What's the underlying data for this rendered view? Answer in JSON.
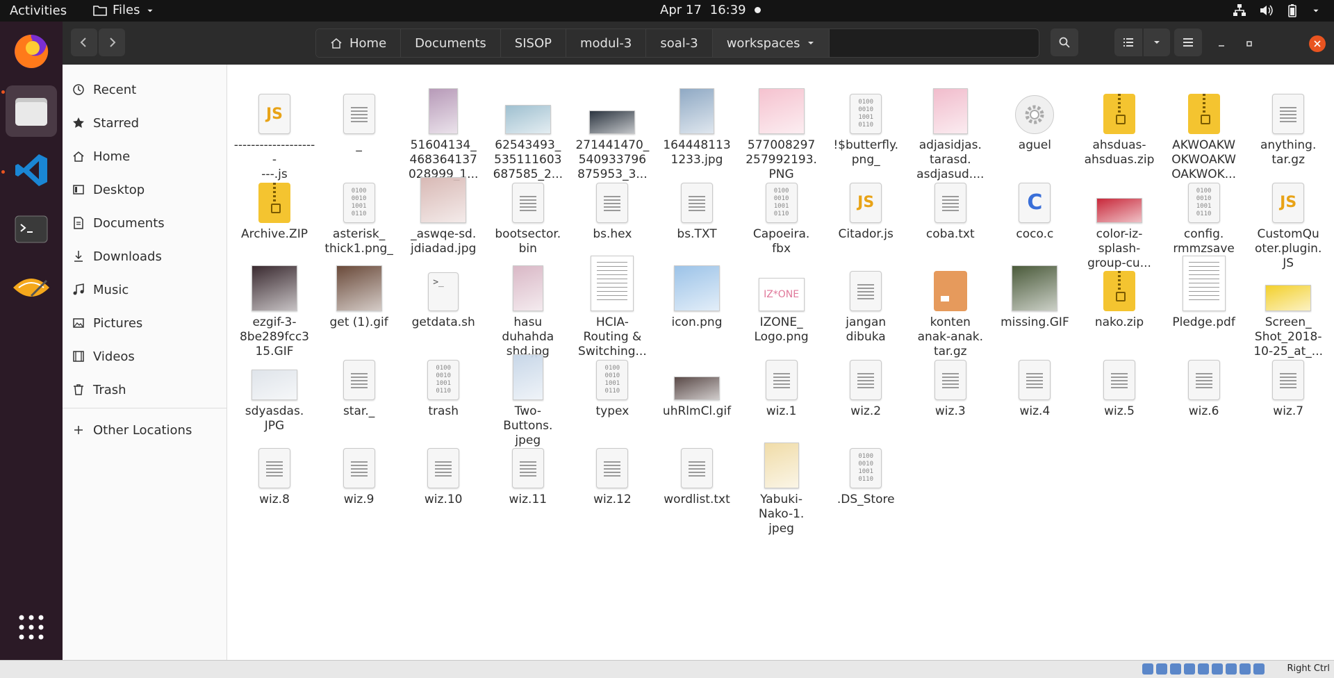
{
  "topbar": {
    "activities": "Activities",
    "app_name": "Files",
    "date": "Apr 17",
    "time": "16:39"
  },
  "dock": {
    "items": [
      "firefox-icon",
      "files-icon",
      "vscode-icon",
      "terminal-icon",
      "gedit-icon",
      "show-apps-icon"
    ]
  },
  "pathbar": {
    "crumbs": [
      "Home",
      "Documents",
      "SISOP",
      "modul-3",
      "soal-3",
      "workspaces"
    ]
  },
  "sidebar": {
    "items": [
      {
        "label": "Recent",
        "icon": "clock-icon"
      },
      {
        "label": "Starred",
        "icon": "star-icon"
      },
      {
        "label": "Home",
        "icon": "home-icon"
      },
      {
        "label": "Desktop",
        "icon": "desktop-icon"
      },
      {
        "label": "Documents",
        "icon": "documents-icon"
      },
      {
        "label": "Downloads",
        "icon": "downloads-icon"
      },
      {
        "label": "Music",
        "icon": "music-icon"
      },
      {
        "label": "Pictures",
        "icon": "pictures-icon"
      },
      {
        "label": "Videos",
        "icon": "videos-icon"
      },
      {
        "label": "Trash",
        "icon": "trash-icon"
      }
    ],
    "other": "Other Locations"
  },
  "files": [
    {
      "name": "--------------------\n---.js",
      "icon": "js"
    },
    {
      "name": "_",
      "icon": "doc"
    },
    {
      "name": "51604134_\n468364137\n028999_1...",
      "icon": "img",
      "color": "#b79ab8",
      "w": 40,
      "h": 64
    },
    {
      "name": "62543493_\n535111603\n687585_2...",
      "icon": "img",
      "color": "#9fc0d0",
      "w": 64,
      "h": 40
    },
    {
      "name": "271441470_\n540933796\n875953_3...",
      "icon": "img",
      "color": "#2c3540",
      "w": 64,
      "h": 32
    },
    {
      "name": "164448113\n1233.jpg",
      "icon": "img",
      "color": "#8fa9c4",
      "w": 48,
      "h": 64
    },
    {
      "name": "577008297\n257992193.\nPNG",
      "icon": "img",
      "color": "#f5c2cf",
      "w": 64,
      "h": 64
    },
    {
      "name": "!$butterfly.\npng_",
      "icon": "bin"
    },
    {
      "name": "adjasidjas.\ntarasd.\nasdjasud....",
      "icon": "img",
      "color": "#f1bccc",
      "w": 48,
      "h": 64
    },
    {
      "name": "aguel",
      "icon": "gear"
    },
    {
      "name": "ahsduas-\nahsduas.zip",
      "icon": "zip"
    },
    {
      "name": "AKWOAKW\nOKWOAKW\nOAKWOK...",
      "icon": "zip"
    },
    {
      "name": "anything.\ntar.gz",
      "icon": "doc"
    },
    {
      "name": "Archive.ZIP",
      "icon": "zip"
    },
    {
      "name": "asterisk_\nthick1.png_",
      "icon": "bin"
    },
    {
      "name": "_aswqe-sd.\njdiadad.jpg",
      "icon": "img",
      "color": "#d8b9b5",
      "w": 64,
      "h": 64
    },
    {
      "name": "bootsector.\nbin",
      "icon": "doc"
    },
    {
      "name": "bs.hex",
      "icon": "doc"
    },
    {
      "name": "bs.TXT",
      "icon": "doc"
    },
    {
      "name": "Capoeira.\nfbx",
      "icon": "bin"
    },
    {
      "name": "Citador.js",
      "icon": "js"
    },
    {
      "name": "coba.txt",
      "icon": "doc"
    },
    {
      "name": "coco.c",
      "icon": "c"
    },
    {
      "name": "color-iz-\nsplash-\ngroup-cu...",
      "icon": "img",
      "color": "#c8283a",
      "w": 64,
      "h": 34
    },
    {
      "name": "config.\nrmmzsave",
      "icon": "bin"
    },
    {
      "name": "CustomQu\noter.plugin.\nJS",
      "icon": "js"
    },
    {
      "name": "ezgif-3-\n8be289fcc3\n15.GIF",
      "icon": "img",
      "color": "#3a2a30",
      "w": 64,
      "h": 64
    },
    {
      "name": "get (1).gif",
      "icon": "img",
      "color": "#6a4a3a",
      "w": 64,
      "h": 64
    },
    {
      "name": "getdata.sh",
      "icon": "sh"
    },
    {
      "name": "hasu\nduhahda\nshd.jpg",
      "icon": "img",
      "color": "#d9b8c6",
      "w": 42,
      "h": 64
    },
    {
      "name": "HCIA-\nRouting &\nSwitching...",
      "icon": "pdf"
    },
    {
      "name": "icon.png",
      "icon": "img",
      "color": "#9cc3e8",
      "w": 64,
      "h": 64
    },
    {
      "name": "IZONE_\nLogo.png",
      "icon": "img",
      "color": "#ffffff",
      "w": 64,
      "h": 46,
      "text": "IZ*ONE"
    },
    {
      "name": "jangan\ndibuka",
      "icon": "doc"
    },
    {
      "name": "konten\nanak-anak.\ntar.gz",
      "icon": "pkg"
    },
    {
      "name": "missing.GIF",
      "icon": "img",
      "color": "#4a5a3a",
      "w": 64,
      "h": 64
    },
    {
      "name": "nako.zip",
      "icon": "zip"
    },
    {
      "name": "Pledge.pdf",
      "icon": "pdf"
    },
    {
      "name": "Screen_\nShot_2018-\n10-25_at_...",
      "icon": "img",
      "color": "#f3d02c",
      "w": 64,
      "h": 36
    },
    {
      "name": "sdyasdas.\nJPG",
      "icon": "img",
      "color": "#dfe4ea",
      "w": 64,
      "h": 42
    },
    {
      "name": "star._",
      "icon": "doc"
    },
    {
      "name": "trash",
      "icon": "bin"
    },
    {
      "name": "Two-\nButtons.\njpeg",
      "icon": "img",
      "color": "#c8d7e8",
      "w": 42,
      "h": 64
    },
    {
      "name": "typex",
      "icon": "bin"
    },
    {
      "name": "uhRlmCl.gif",
      "icon": "img",
      "color": "#5a4a48",
      "w": 64,
      "h": 32
    },
    {
      "name": "wiz.1",
      "icon": "doc"
    },
    {
      "name": "wiz.2",
      "icon": "doc"
    },
    {
      "name": "wiz.3",
      "icon": "doc"
    },
    {
      "name": "wiz.4",
      "icon": "doc"
    },
    {
      "name": "wiz.5",
      "icon": "doc"
    },
    {
      "name": "wiz.6",
      "icon": "doc"
    },
    {
      "name": "wiz.7",
      "icon": "doc"
    },
    {
      "name": "wiz.8",
      "icon": "doc"
    },
    {
      "name": "wiz.9",
      "icon": "doc"
    },
    {
      "name": "wiz.10",
      "icon": "doc"
    },
    {
      "name": "wiz.11",
      "icon": "doc"
    },
    {
      "name": "wiz.12",
      "icon": "doc"
    },
    {
      "name": "wordlist.txt",
      "icon": "doc"
    },
    {
      "name": "Yabuki-\nNako-1.\njpeg",
      "icon": "img",
      "color": "#f0dca8",
      "w": 48,
      "h": 64
    },
    {
      "name": ".DS_Store",
      "icon": "bin"
    }
  ],
  "statusbar": {
    "host_key": "Right Ctrl"
  },
  "colors": {
    "accent": "#e95420",
    "headerbar": "#2c2c2c",
    "dock": "#2b1a26",
    "zip": "#f4c430",
    "js": "#e8a317"
  }
}
